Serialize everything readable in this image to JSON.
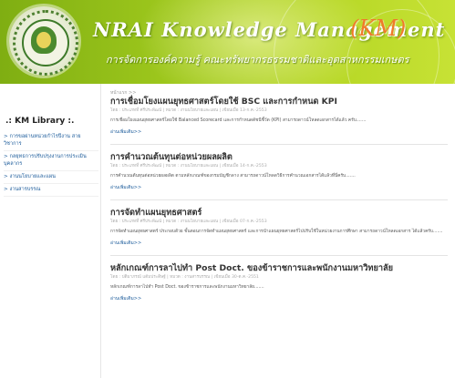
{
  "header": {
    "title_main": "NRAI Knowledge Management",
    "title_accent": "(KM)",
    "subtitle": "การจัดการองค์ความรู้ คณะทรัพยากรธรรมชาติและอุตสาหกรรมเกษตร",
    "logo_icon": "university-seal-icon"
  },
  "sidebar": {
    "heading": ".: KM Library :.",
    "items": [
      {
        "label": "> การขอผ่านหน่วยกำไรปีงาน สายวิชาการ"
      },
      {
        "label": "> กลยุทธการปรับปรุงงานการประเมินบุคลากร"
      },
      {
        "label": "> งานนโยบายและแผน"
      },
      {
        "label": "> งานสารบรรณ"
      }
    ]
  },
  "content": {
    "breadcrumb": "หน้าแรก >>",
    "articles": [
      {
        "title": "การเชื่อมโยงแผนยุทธศาสตร์โดยใช้ BSC และการกำหนด KPI",
        "meta": "โดย : ประเภทที่ ศรีประพัฒน์ | หมวด : งานนโยบายและแผน | เขียนเมื่อ 13-ก.ค.-2553",
        "body": "การเชื่อมโยงแผนยุทธศาสตร์โดยใช้ Balanced Scorecard และการกำหนดดัชนีชี้วัด (KPI) สามารถดาวน์โหลดเอกสารได้แล้ว ครับ.......",
        "more": "อ่านเพิ่มเติม>>"
      },
      {
        "title": "การคำนวณต้นทุนต่อหน่วยผลผลิต",
        "meta": "โดย : ประเภทที่ ศรีประพัฒน์ | หมวด : งานนโยบายและแผน | เขียนเมื่อ 14-ก.ค.-2553",
        "body": "การคำนวณต้นทุนต่อหน่วยผลผลิต ตามหลักเกณฑ์ของกรมบัญชีกลาง สามารถดาวน์โหลดวิธีการคำนวณเอกสารได้แล้วที่นี่ครับ.......",
        "more": "อ่านเพิ่มเติม>>"
      },
      {
        "title": "การจัดทำแผนยุทธศาสตร์",
        "meta": "โดย : ประเภทที่ ศรีประพัฒน์ | หมวด : งานนโยบายและแผน | เขียนเมื่อ 07-ก.ค.-2553",
        "body": "การจัดทำแผนยุทธศาสตร์ ประกอบด้วย ขั้นตอนการจัดทำแผนยุทธศาสตร์ และการนำแผนยุทธศาสตร์ไปปรับใช้ในหน่วยงานการศึกษา สามารถดาวน์โหลดเอกสาร ได้แล้วครับ.......",
        "more": "อ่านเพิ่มเติม>>"
      },
      {
        "title": "หลักเกณฑ์การลาไปทำ Post Doct. ของข้าราชการและพนักงานมหาวิทยาลัย",
        "meta": "โดย : ปติมาภรณ์ แต้มประดิษฐ์ | หมวด : งานสารบรรณ | เขียนเมื่อ 30-ต.ค.-2551",
        "body": "หลักเกณฑ์การลาไปทำ Post Doct. ของข้าราชการและพนักงานมหาวิทยาลัย.......",
        "more": "อ่านเพิ่มเติม>>"
      }
    ]
  }
}
